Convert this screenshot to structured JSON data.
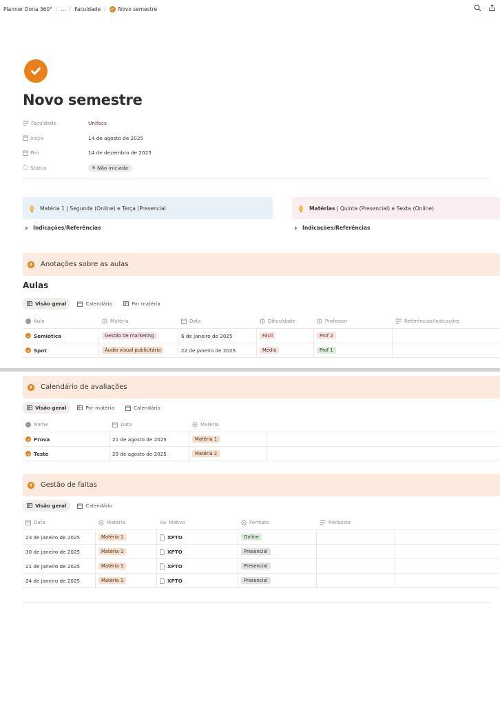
{
  "breadcrumb": {
    "root": "Planner Dona 360°",
    "ellipsis": "...",
    "parent": "Faculdade",
    "current": "Novo semestre"
  },
  "page": {
    "title": "Novo semestre"
  },
  "properties": [
    {
      "label": "Faculdade",
      "value": "Unifacs"
    },
    {
      "label": "Início",
      "value": "14 de agosto de 2025"
    },
    {
      "label": "Fim",
      "value": "14 de dezembro de 2025"
    },
    {
      "label": "Status",
      "value": "Não iniciada"
    }
  ],
  "callouts": [
    {
      "text": "Matéria 1 | Segunda (Online) e Terça (Presencial",
      "bg": "#e7f1f7"
    },
    {
      "text_bold": "Matérias",
      "text": " | Quinta (Presencial) e Sexta (Online)",
      "bg": "#fbeef1"
    }
  ],
  "toggles": [
    "Indicações/Referências",
    "Indicações/Referências"
  ],
  "sections": {
    "aulas_header": "Anotações sobre as aulas",
    "aulas_title": "Aulas",
    "avaliacoes_header": "Calendário de avaliações",
    "faltas_header": "Gestão de faltas"
  },
  "aulas": {
    "views": [
      "Visão geral",
      "Calendário",
      "Por matéria"
    ],
    "columns": [
      "Aula",
      "Matéria",
      "Data",
      "Dificuldade",
      "Professor",
      "Referências/Indicações"
    ],
    "rows": [
      {
        "aula": "Semiótica",
        "materia": "Gestão de marketing",
        "data": "6 de janeiro de 2025",
        "dificuldade": "Fácil",
        "professor": "Prof 2",
        "ref": ""
      },
      {
        "aula": "Spot",
        "materia": "Áudio visual publicitário",
        "data": "22 de janeiro de 2025",
        "dificuldade": "Médio",
        "professor": "Prof 1",
        "ref": ""
      }
    ]
  },
  "avaliacoes": {
    "views": [
      "Visão geral",
      "Por matéria",
      "Calendário"
    ],
    "columns": [
      "Nome",
      "Data",
      "Matéria"
    ],
    "rows": [
      {
        "nome": "Prova",
        "data": "21 de agosto de 2025",
        "materia": "Matéria 1"
      },
      {
        "nome": "Teste",
        "data": "29 de agosto de 2025",
        "materia": "Matéria 2"
      }
    ]
  },
  "faltas": {
    "views": [
      "Visão geral",
      "Calendário"
    ],
    "columns": [
      "Data",
      "Matéria",
      "Motivo",
      "Formato",
      "Professor"
    ],
    "rows": [
      {
        "data": "23 de janeiro de 2025",
        "materia": "Matéria 1",
        "motivo": "XPTO",
        "formato": "Online"
      },
      {
        "data": "30 de janeiro de 2025",
        "materia": "Matéria 1",
        "motivo": "XPTO",
        "formato": "Presencial"
      },
      {
        "data": "21 de janeiro de 2025",
        "materia": "Matéria 1",
        "motivo": "XPTO",
        "formato": "Presencial"
      },
      {
        "data": "24 de janeiro de 2025",
        "materia": "Matéria 1",
        "motivo": "XPTO",
        "formato": "Presencial"
      }
    ]
  },
  "icons": [
    "check-icon",
    "search-icon",
    "share-icon",
    "text-lines-icon",
    "calendar-icon",
    "status-icon",
    "bulb-icon",
    "toggle-triangle-icon",
    "arrow-up-circle-icon",
    "table-icon",
    "relation-icon",
    "title-icon",
    "file-icon"
  ],
  "colors": {
    "accent": "#e8811c",
    "section_bg": "#fbeadd"
  }
}
